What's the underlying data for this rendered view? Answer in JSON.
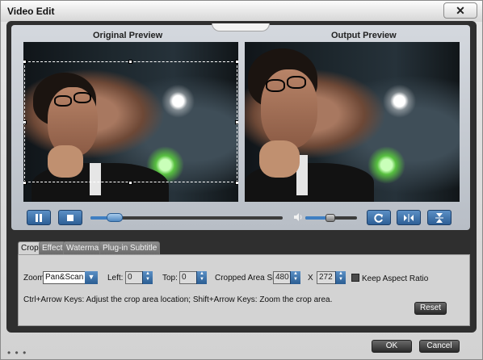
{
  "window": {
    "title": "Video Edit",
    "close_glyph": "✕"
  },
  "preview": {
    "original_title": "Original Preview",
    "output_title": "Output Preview"
  },
  "playback": {
    "play_pause_icon": "pause-icon",
    "stop_icon": "stop-icon",
    "seek_position_fraction": 0.12,
    "volume_fraction": 0.45,
    "volume_icon": "speaker-icon",
    "rotate_icon": "rotate-icon",
    "flip_horizontal_icon": "flip-horizontal-icon",
    "flip_vertical_icon": "flip-vertical-icon"
  },
  "tabs": [
    {
      "label": "Crop",
      "active": true
    },
    {
      "label": "Effect",
      "active": false
    },
    {
      "label": "Watermark",
      "active": false
    },
    {
      "label": "Plug-in Subtitle",
      "active": false
    }
  ],
  "crop": {
    "zoom_label": "Zoom:",
    "zoom_value": "Pan&Scan",
    "left_label": "Left:",
    "left_value": "0",
    "top_label": "Top:",
    "top_value": "0",
    "area_label": "Cropped Area Size:",
    "width_value": "480",
    "x_separator": "X",
    "height_value": "272",
    "keep_aspect_label": "Keep Aspect Ratio",
    "hint": "Ctrl+Arrow Keys: Adjust the crop area location; Shift+Arrow Keys: Zoom the crop area.",
    "reset_label": "Reset"
  },
  "footer": {
    "ok_label": "OK",
    "cancel_label": "Cancel",
    "grip": "• • •"
  },
  "colors": {
    "accent": "#3f7fc2",
    "frame": "#2f2f2f",
    "panel": "#d3d3d3"
  }
}
